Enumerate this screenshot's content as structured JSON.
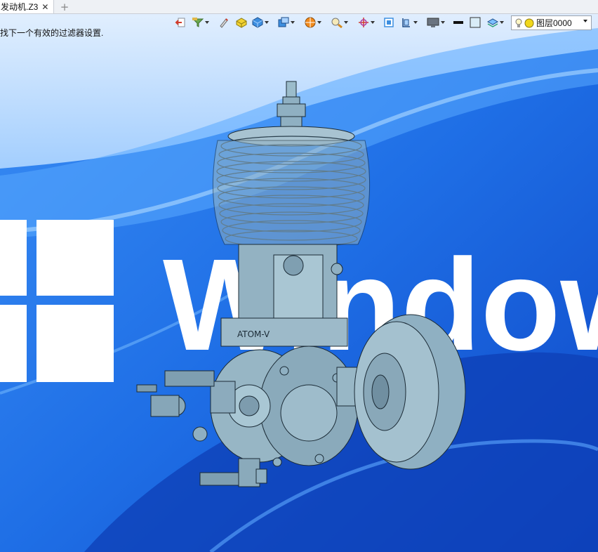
{
  "tab": {
    "title": "发动机.Z3",
    "close_glyph": "✕",
    "add_glyph": "+"
  },
  "status": {
    "message": "找下一个有效的过滤器设置."
  },
  "toolbar": {
    "icons": [
      "exit-icon",
      "filter-icon",
      "pen-icon",
      "solid-icon",
      "cube-view-icon",
      "view-orient-icon",
      "render-mode-icon",
      "zoom-icon",
      "pan-icon",
      "fit-view-icon",
      "section-icon",
      "display-icon",
      "line-color-icon",
      "fill-color-icon",
      "layer-stack-icon"
    ],
    "layer": {
      "label": "图层0000",
      "bulb_color": "#f1d71c"
    }
  },
  "viewport": {
    "model_label": "ATOM-V",
    "wallpaper_text": "Windows",
    "model_color": "#8fb0c2"
  }
}
